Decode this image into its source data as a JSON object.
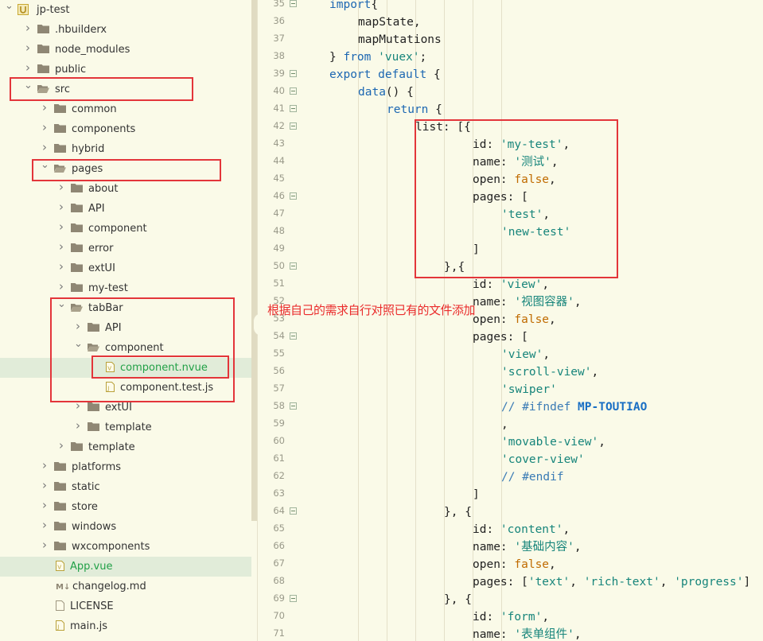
{
  "sidebar": {
    "items": [
      {
        "label": "jp-test",
        "kind": "project",
        "depth": 0,
        "state": "open"
      },
      {
        "label": ".hbuilderx",
        "kind": "folder",
        "depth": 1,
        "state": "closed"
      },
      {
        "label": "node_modules",
        "kind": "folder",
        "depth": 1,
        "state": "closed"
      },
      {
        "label": "public",
        "kind": "folder",
        "depth": 1,
        "state": "closed"
      },
      {
        "label": "src",
        "kind": "folder",
        "depth": 1,
        "state": "open"
      },
      {
        "label": "common",
        "kind": "folder",
        "depth": 2,
        "state": "closed"
      },
      {
        "label": "components",
        "kind": "folder",
        "depth": 2,
        "state": "closed"
      },
      {
        "label": "hybrid",
        "kind": "folder",
        "depth": 2,
        "state": "closed"
      },
      {
        "label": "pages",
        "kind": "folder",
        "depth": 2,
        "state": "open"
      },
      {
        "label": "about",
        "kind": "folder",
        "depth": 3,
        "state": "closed"
      },
      {
        "label": "API",
        "kind": "folder",
        "depth": 3,
        "state": "closed"
      },
      {
        "label": "component",
        "kind": "folder",
        "depth": 3,
        "state": "closed"
      },
      {
        "label": "error",
        "kind": "folder",
        "depth": 3,
        "state": "closed"
      },
      {
        "label": "extUI",
        "kind": "folder",
        "depth": 3,
        "state": "closed"
      },
      {
        "label": "my-test",
        "kind": "folder",
        "depth": 3,
        "state": "closed"
      },
      {
        "label": "tabBar",
        "kind": "folder",
        "depth": 3,
        "state": "open"
      },
      {
        "label": "API",
        "kind": "folder",
        "depth": 4,
        "state": "closed"
      },
      {
        "label": "component",
        "kind": "folder",
        "depth": 4,
        "state": "open"
      },
      {
        "label": "component.nvue",
        "kind": "vue",
        "depth": 5,
        "state": "none",
        "selected": true
      },
      {
        "label": "component.test.js",
        "kind": "js",
        "depth": 5,
        "state": "none"
      },
      {
        "label": "extUI",
        "kind": "folder",
        "depth": 4,
        "state": "closed"
      },
      {
        "label": "template",
        "kind": "folder",
        "depth": 4,
        "state": "closed"
      },
      {
        "label": "template",
        "kind": "folder",
        "depth": 3,
        "state": "closed"
      },
      {
        "label": "platforms",
        "kind": "folder",
        "depth": 2,
        "state": "closed"
      },
      {
        "label": "static",
        "kind": "folder",
        "depth": 2,
        "state": "closed"
      },
      {
        "label": "store",
        "kind": "folder",
        "depth": 2,
        "state": "closed"
      },
      {
        "label": "windows",
        "kind": "folder",
        "depth": 2,
        "state": "closed"
      },
      {
        "label": "wxcomponents",
        "kind": "folder",
        "depth": 2,
        "state": "closed"
      },
      {
        "label": "App.vue",
        "kind": "vue",
        "depth": 2,
        "state": "none",
        "selected": true
      },
      {
        "label": "changelog.md",
        "kind": "md",
        "depth": 2,
        "state": "none"
      },
      {
        "label": "LICENSE",
        "kind": "file",
        "depth": 2,
        "state": "none"
      },
      {
        "label": "main.js",
        "kind": "js",
        "depth": 2,
        "state": "none"
      }
    ]
  },
  "editor": {
    "lines": [
      {
        "n": "35",
        "fold": true,
        "indent": 1,
        "tokens": [
          [
            "kw",
            "import"
          ],
          [
            "",
            "{"
          ]
        ]
      },
      {
        "n": "36",
        "fold": false,
        "indent": 2,
        "tokens": [
          [
            "",
            "mapState,"
          ]
        ]
      },
      {
        "n": "37",
        "fold": false,
        "indent": 2,
        "tokens": [
          [
            "",
            "mapMutations"
          ]
        ]
      },
      {
        "n": "38",
        "fold": false,
        "indent": 1,
        "tokens": [
          [
            "",
            "} "
          ],
          [
            "kw",
            "from"
          ],
          [
            "",
            " "
          ],
          [
            "str",
            "'vuex'"
          ],
          [
            "",
            ";"
          ]
        ]
      },
      {
        "n": "39",
        "fold": true,
        "indent": 1,
        "tokens": [
          [
            "kw",
            "export default"
          ],
          [
            "",
            " {"
          ]
        ]
      },
      {
        "n": "40",
        "fold": true,
        "indent": 2,
        "tokens": [
          [
            "kw",
            "data"
          ],
          [
            "",
            "() {"
          ]
        ]
      },
      {
        "n": "41",
        "fold": true,
        "indent": 3,
        "tokens": [
          [
            "kw",
            "return"
          ],
          [
            "",
            " {"
          ]
        ]
      },
      {
        "n": "42",
        "fold": true,
        "indent": 4,
        "tokens": [
          [
            "",
            "list: [{"
          ]
        ]
      },
      {
        "n": "43",
        "fold": false,
        "indent": 6,
        "tokens": [
          [
            "",
            "id: "
          ],
          [
            "str",
            "'my-test'"
          ],
          [
            "",
            ","
          ]
        ]
      },
      {
        "n": "44",
        "fold": false,
        "indent": 6,
        "tokens": [
          [
            "",
            "name: "
          ],
          [
            "str",
            "'测试'"
          ],
          [
            "",
            ","
          ]
        ]
      },
      {
        "n": "45",
        "fold": false,
        "indent": 6,
        "tokens": [
          [
            "",
            "open: "
          ],
          [
            "bool",
            "false"
          ],
          [
            "",
            ","
          ]
        ]
      },
      {
        "n": "46",
        "fold": true,
        "indent": 6,
        "tokens": [
          [
            "",
            "pages: ["
          ]
        ]
      },
      {
        "n": "47",
        "fold": false,
        "indent": 7,
        "tokens": [
          [
            "str",
            "'test'"
          ],
          [
            "",
            ","
          ]
        ]
      },
      {
        "n": "48",
        "fold": false,
        "indent": 7,
        "tokens": [
          [
            "str",
            "'new-test'"
          ]
        ]
      },
      {
        "n": "49",
        "fold": false,
        "indent": 6,
        "tokens": [
          [
            "",
            "]"
          ]
        ]
      },
      {
        "n": "50",
        "fold": true,
        "indent": 5,
        "tokens": [
          [
            "",
            "},{"
          ]
        ]
      },
      {
        "n": "51",
        "fold": false,
        "indent": 6,
        "tokens": [
          [
            "",
            "id: "
          ],
          [
            "str",
            "'view'"
          ],
          [
            "",
            ","
          ]
        ]
      },
      {
        "n": "52",
        "fold": false,
        "indent": 6,
        "tokens": [
          [
            "",
            "name: "
          ],
          [
            "str",
            "'视图容器'"
          ],
          [
            "",
            ","
          ]
        ]
      },
      {
        "n": "53",
        "fold": false,
        "indent": 6,
        "tokens": [
          [
            "",
            "open: "
          ],
          [
            "bool",
            "false"
          ],
          [
            "",
            ","
          ]
        ]
      },
      {
        "n": "54",
        "fold": true,
        "indent": 6,
        "tokens": [
          [
            "",
            "pages: ["
          ]
        ]
      },
      {
        "n": "55",
        "fold": false,
        "indent": 7,
        "tokens": [
          [
            "str",
            "'view'"
          ],
          [
            "",
            ","
          ]
        ]
      },
      {
        "n": "56",
        "fold": false,
        "indent": 7,
        "tokens": [
          [
            "str",
            "'scroll-view'"
          ],
          [
            "",
            ","
          ]
        ]
      },
      {
        "n": "57",
        "fold": false,
        "indent": 7,
        "tokens": [
          [
            "str",
            "'swiper'"
          ]
        ]
      },
      {
        "n": "58",
        "fold": true,
        "indent": 7,
        "tokens": [
          [
            "cm",
            "// #ifndef "
          ],
          [
            "cmb",
            "MP-TOUTIAO"
          ]
        ]
      },
      {
        "n": "59",
        "fold": false,
        "indent": 7,
        "tokens": [
          [
            "",
            ","
          ]
        ]
      },
      {
        "n": "60",
        "fold": false,
        "indent": 7,
        "tokens": [
          [
            "str",
            "'movable-view'"
          ],
          [
            "",
            ","
          ]
        ]
      },
      {
        "n": "61",
        "fold": false,
        "indent": 7,
        "tokens": [
          [
            "str",
            "'cover-view'"
          ]
        ]
      },
      {
        "n": "62",
        "fold": false,
        "indent": 7,
        "tokens": [
          [
            "cm",
            "// #endif"
          ]
        ]
      },
      {
        "n": "63",
        "fold": false,
        "indent": 6,
        "tokens": [
          [
            "",
            "]"
          ]
        ]
      },
      {
        "n": "64",
        "fold": true,
        "indent": 5,
        "tokens": [
          [
            "",
            "}, {"
          ]
        ]
      },
      {
        "n": "65",
        "fold": false,
        "indent": 6,
        "tokens": [
          [
            "",
            "id: "
          ],
          [
            "str",
            "'content'"
          ],
          [
            "",
            ","
          ]
        ]
      },
      {
        "n": "66",
        "fold": false,
        "indent": 6,
        "tokens": [
          [
            "",
            "name: "
          ],
          [
            "str",
            "'基础内容'"
          ],
          [
            "",
            ","
          ]
        ]
      },
      {
        "n": "67",
        "fold": false,
        "indent": 6,
        "tokens": [
          [
            "",
            "open: "
          ],
          [
            "bool",
            "false"
          ],
          [
            "",
            ","
          ]
        ]
      },
      {
        "n": "68",
        "fold": false,
        "indent": 6,
        "tokens": [
          [
            "",
            "pages: ["
          ],
          [
            "str",
            "'text'"
          ],
          [
            "",
            ", "
          ],
          [
            "str",
            "'rich-text'"
          ],
          [
            "",
            ", "
          ],
          [
            "str",
            "'progress'"
          ],
          [
            "",
            "]"
          ]
        ]
      },
      {
        "n": "69",
        "fold": true,
        "indent": 5,
        "tokens": [
          [
            "",
            "}, {"
          ]
        ]
      },
      {
        "n": "70",
        "fold": false,
        "indent": 6,
        "tokens": [
          [
            "",
            "id: "
          ],
          [
            "str",
            "'form'"
          ],
          [
            "",
            ","
          ]
        ]
      },
      {
        "n": "71",
        "fold": false,
        "indent": 6,
        "tokens": [
          [
            "",
            "name: "
          ],
          [
            "str",
            "'表单组件'"
          ],
          [
            "",
            ","
          ]
        ]
      }
    ]
  },
  "annotation": {
    "text": "根据自己的需求自行对照已有的文件添加"
  },
  "colors": {
    "highlight": "#e3353a",
    "background": "#fafae8",
    "selected_row": "#e1ecd9",
    "keyword": "#1c67b2",
    "string": "#17857b"
  }
}
